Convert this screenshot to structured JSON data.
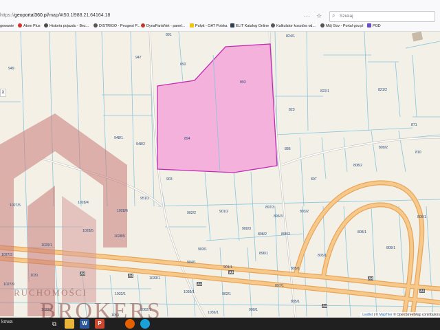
{
  "browser": {
    "url_protocol": "https://",
    "url_host": "geoportal360.pl",
    "url_path": "/map/#t50.1l988.21.64164.18",
    "search_placeholder": "Szukaj",
    "menu_icon": "more-dots-icon",
    "bookmark_star_icon": "star-icon"
  },
  "bookmarks": [
    {
      "label": "gowanie",
      "color": "#888888"
    },
    {
      "label": "Atom Plus",
      "color": "#d3312a"
    },
    {
      "label": "Historia pojazdu - Bez...",
      "color": "#4a4a4a"
    },
    {
      "label": "DISTRIGO - Peugeot P...",
      "color": "#555555"
    },
    {
      "label": "DynaPartsNet - panel...",
      "color": "#c0392b"
    },
    {
      "label": "Pulpit - OAT Polska",
      "color": "#f1c40f"
    },
    {
      "label": "ELIT Katalog Online",
      "color": "#2c3e50"
    },
    {
      "label": "Kalkulator kosztów od...",
      "color": "#555555"
    },
    {
      "label": "Mój Gov - Portal gov.pl",
      "color": "#555555"
    },
    {
      "label": "PGD",
      "color": "#6a4cc2"
    }
  ],
  "map": {
    "selected_parcel_fill": "#f2a6d8",
    "selected_parcel_stroke": "#c42bb5",
    "road_color": "#f0b56a",
    "parcel_line_color": "#7fc3dc",
    "road_labels": [
      "A4",
      "A4",
      "A4",
      "A4",
      "A4",
      "A4",
      "A4"
    ],
    "parcel_labels": [
      "891",
      "892",
      "893",
      "894",
      "903",
      "947",
      "949",
      "948/1",
      "948/2",
      "824/1",
      "822/1",
      "821/2",
      "823",
      "871",
      "886",
      "809/2",
      "810",
      "808/2",
      "807",
      "902/2",
      "901/2",
      "897/3",
      "896/3",
      "900/3",
      "898/2",
      "895/2",
      "896/1",
      "903/1",
      "904/1",
      "901/1",
      "895/1",
      "897/1",
      "902/1",
      "900/1",
      "895/1",
      "803/2",
      "808/1",
      "806/1",
      "809/1",
      "803/1",
      "1028/4",
      "1028/6",
      "1028/5",
      "1028/5",
      "951/2",
      "1027/5",
      "1029/1",
      "1027/3",
      "1031",
      "1033/1",
      "1032/1",
      "1035/1",
      "1036/1",
      "1027/9",
      "1032/2",
      "1062/1",
      "1051"
    ]
  },
  "side_close": "X",
  "attribution": {
    "leaflet": "Leaflet",
    "sep1": " | © ",
    "mapbox": "MapTiler",
    "rest": " © OpenStreetMap contributors"
  },
  "watermark": {
    "line1": "RUCHOMOŚCI",
    "line2": "BROKERS"
  },
  "taskbar": {
    "status_text": "kowa",
    "icons": [
      "taskbar-app-icon",
      "explorer-icon",
      "word-icon",
      "powerpoint-icon",
      "firefox-icon",
      "edge-icon"
    ]
  }
}
